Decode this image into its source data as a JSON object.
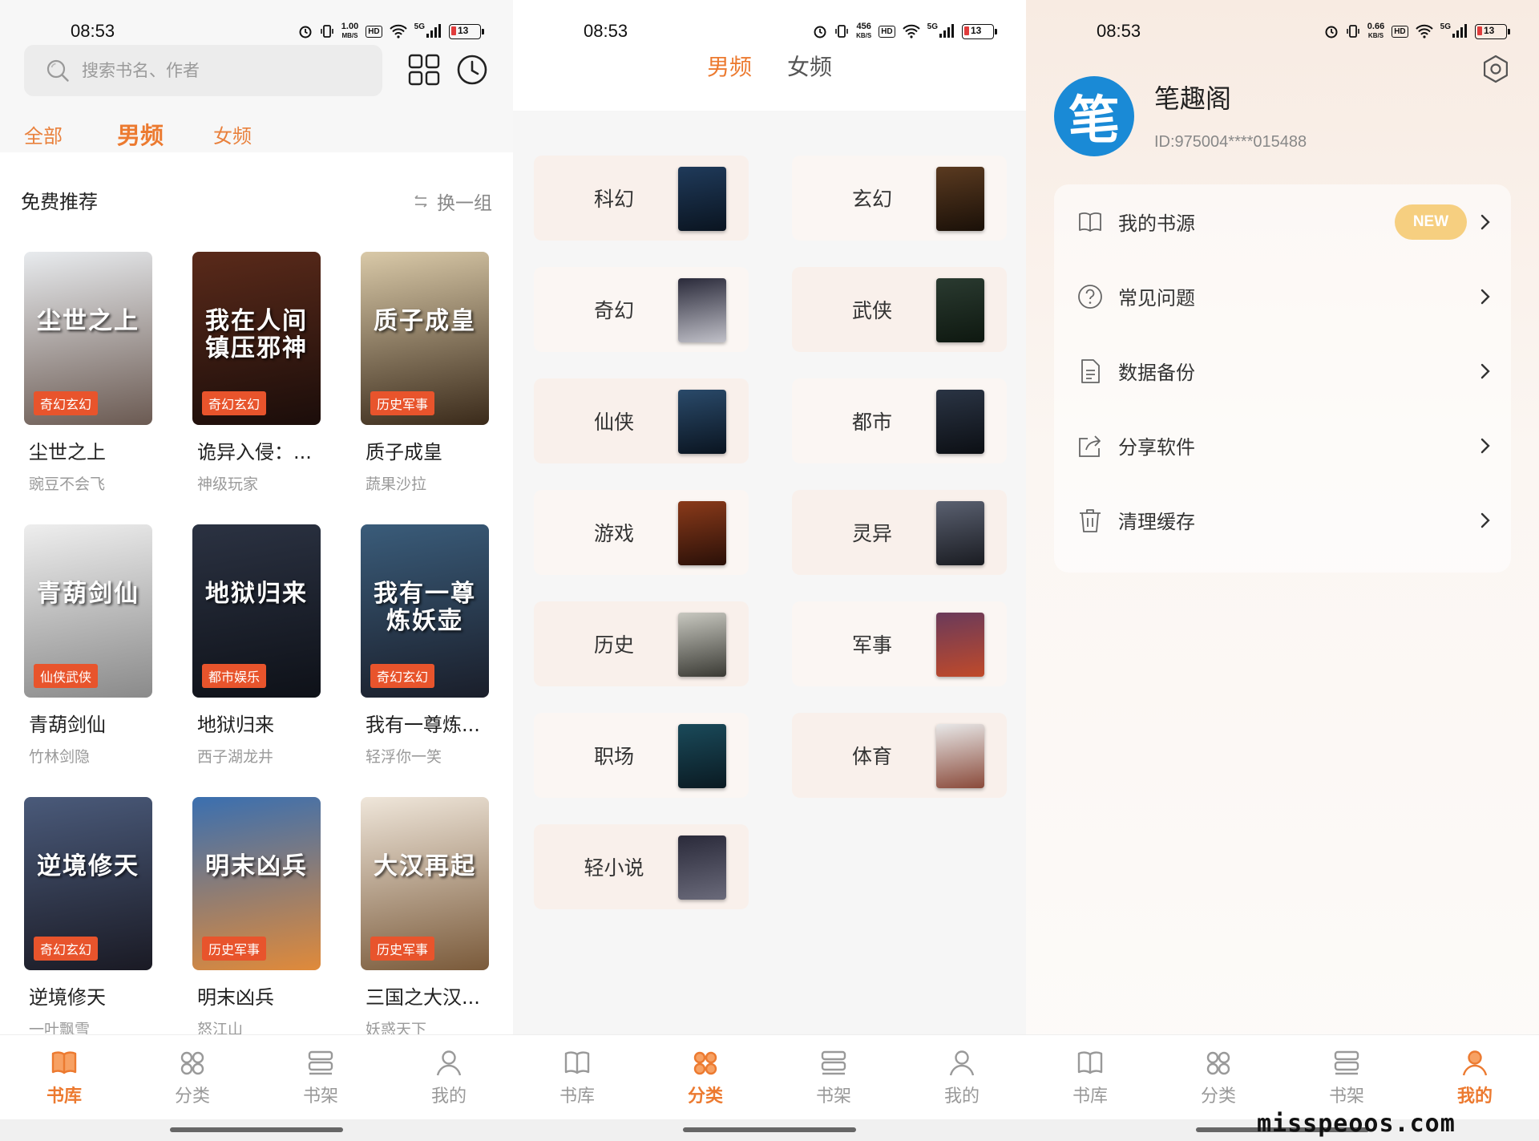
{
  "library": {
    "status": {
      "time": "08:53",
      "speed_top": "1.00",
      "speed_unit": "MB/S",
      "battery": "13",
      "signal": "5G"
    },
    "search_placeholder": "搜索书名、作者",
    "tabs": [
      "全部",
      "男频",
      "女频"
    ],
    "section_title": "免费推荐",
    "refresh_label": "换一组",
    "books": [
      {
        "title": "尘世之上",
        "author": "豌豆不会飞",
        "tag": "奇幻玄幻",
        "cover_text": "尘世之上",
        "c1": "#e8ebee",
        "c2": "#6b5a52"
      },
      {
        "title": "诡异入侵：...",
        "author": "神级玩家",
        "tag": "奇幻玄幻",
        "cover_text": "我在人间镇压邪神",
        "c1": "#5a2a1a",
        "c2": "#1b0d0a"
      },
      {
        "title": "质子成皇",
        "author": "蔬果沙拉",
        "tag": "历史军事",
        "cover_text": "质子成皇",
        "c1": "#d9c9a8",
        "c2": "#3a2a1a"
      },
      {
        "title": "青葫剑仙",
        "author": "竹林剑隐",
        "tag": "仙侠武侠",
        "cover_text": "青葫剑仙",
        "c1": "#eeeeee",
        "c2": "#8a8a8a"
      },
      {
        "title": "地狱归来",
        "author": "西子湖龙井",
        "tag": "都市娱乐",
        "cover_text": "地狱归来",
        "c1": "#2b3242",
        "c2": "#0e1118"
      },
      {
        "title": "我有一尊炼...",
        "author": "轻浮你一笑",
        "tag": "奇幻玄幻",
        "cover_text": "我有一尊炼妖壶",
        "c1": "#3a5c7a",
        "c2": "#1a1e2a"
      },
      {
        "title": "逆境修天",
        "author": "一叶飘雪",
        "tag": "奇幻玄幻",
        "cover_text": "逆境修天",
        "c1": "#4a5a7a",
        "c2": "#1a1a24"
      },
      {
        "title": "明末凶兵",
        "author": "怒江山",
        "tag": "历史军事",
        "cover_text": "明末凶兵",
        "c1": "#3a6fb0",
        "c2": "#e08a3a"
      },
      {
        "title": "三国之大汉...",
        "author": "妖惑天下",
        "tag": "历史军事",
        "cover_text": "大汉再起",
        "c1": "#efe6da",
        "c2": "#7a5a3a"
      }
    ]
  },
  "category": {
    "status": {
      "time": "08:53",
      "speed_top": "456",
      "speed_unit": "KB/S",
      "battery": "13",
      "signal": "5G"
    },
    "gender_tabs": [
      "男频",
      "女频"
    ],
    "items": [
      {
        "label": "科幻",
        "c1": "#1f3a5a",
        "c2": "#0a1420"
      },
      {
        "label": "玄幻",
        "c1": "#5a3a20",
        "c2": "#1a1008"
      },
      {
        "label": "奇幻",
        "c1": "#2a2a3a",
        "c2": "#c0c0c8"
      },
      {
        "label": "武侠",
        "c1": "#2a3a30",
        "c2": "#0e1810"
      },
      {
        "label": "仙侠",
        "c1": "#2a4a6a",
        "c2": "#0a1420"
      },
      {
        "label": "都市",
        "c1": "#2a3444",
        "c2": "#0c0f14"
      },
      {
        "label": "游戏",
        "c1": "#8a3a1a",
        "c2": "#2a1008"
      },
      {
        "label": "灵异",
        "c1": "#5a6070",
        "c2": "#1a1c22"
      },
      {
        "label": "历史",
        "c1": "#c8c8c0",
        "c2": "#3a3a34"
      },
      {
        "label": "军事",
        "c1": "#6a3a5a",
        "c2": "#c04a2a"
      },
      {
        "label": "职场",
        "c1": "#1a4a5a",
        "c2": "#0a1a22"
      },
      {
        "label": "体育",
        "c1": "#e8e8e8",
        "c2": "#8a4a3a"
      },
      {
        "label": "轻小说",
        "c1": "#2a2a3a",
        "c2": "#6a6a7a"
      }
    ]
  },
  "profile": {
    "status": {
      "time": "08:53",
      "speed_top": "0.66",
      "speed_unit": "KB/S",
      "battery": "13",
      "signal": "5G"
    },
    "avatar_char": "笔",
    "username": "笔趣阁",
    "user_id": "ID:975004****015488",
    "menu": [
      {
        "label": "我的书源",
        "badge": "NEW"
      },
      {
        "label": "常见问题"
      },
      {
        "label": "数据备份"
      },
      {
        "label": "分享软件"
      },
      {
        "label": "清理缓存"
      }
    ],
    "watermark": "misspeoos.com"
  },
  "nav": [
    "书库",
    "分类",
    "书架",
    "我的"
  ],
  "colors": {
    "accent": "#ec7a30",
    "tag": "#e8542c",
    "badge": "#f6cf80"
  }
}
